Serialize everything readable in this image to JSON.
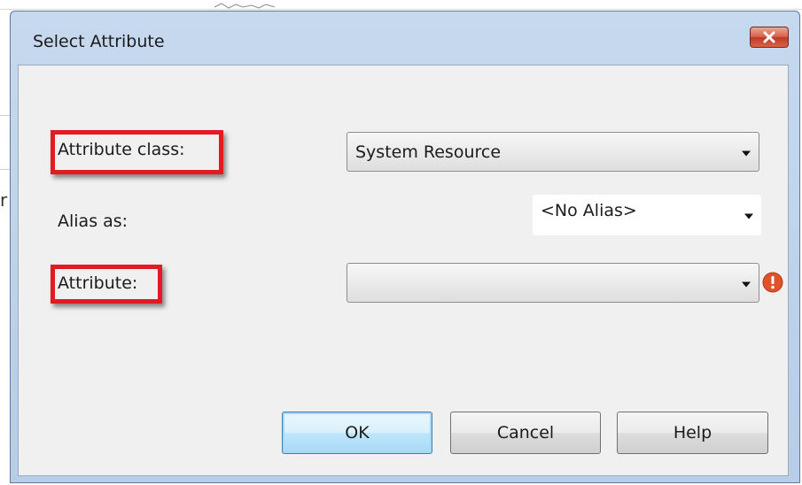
{
  "dialog": {
    "title": "Select Attribute",
    "close_icon": "close-icon"
  },
  "form": {
    "attribute_class_label": "Attribute class:",
    "attribute_class_value": "System Resource",
    "alias_label": "Alias as:",
    "alias_value": "<No Alias>",
    "attribute_label": "Attribute:",
    "attribute_value": "",
    "error_icon": "error-icon"
  },
  "buttons": {
    "ok": "OK",
    "cancel": "Cancel",
    "help": "Help"
  },
  "background": {
    "left_glyph": "r"
  },
  "colors": {
    "highlight": "#e21b23",
    "title_bar": "#c6d9ee",
    "close_button": "#d8604a",
    "error_icon": "#e0522a"
  }
}
